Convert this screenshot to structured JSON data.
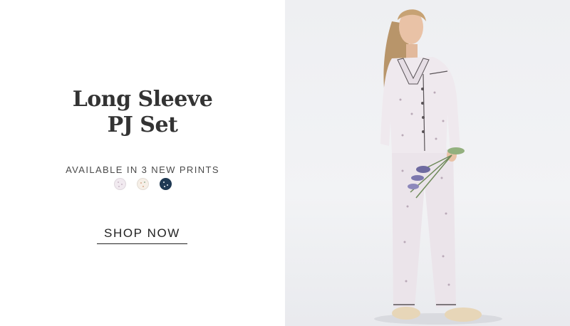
{
  "hero": {
    "title_line1": "Long Sleeve",
    "title_line2": "PJ Set",
    "subtitle": "AVAILABLE IN 3 NEW PRINTS",
    "cta_label": "SHOP NOW"
  },
  "swatches": [
    {
      "name": "light-lavender-print",
      "color": "#f1eaf0"
    },
    {
      "name": "cream-floral-print",
      "color": "#f6efe7"
    },
    {
      "name": "navy-print",
      "color": "#1f3a55"
    }
  ],
  "colors": {
    "text": "#333333",
    "photo_background": "#eeeff2",
    "pajama": "#ebe4ea",
    "piping": "#5a5458"
  }
}
